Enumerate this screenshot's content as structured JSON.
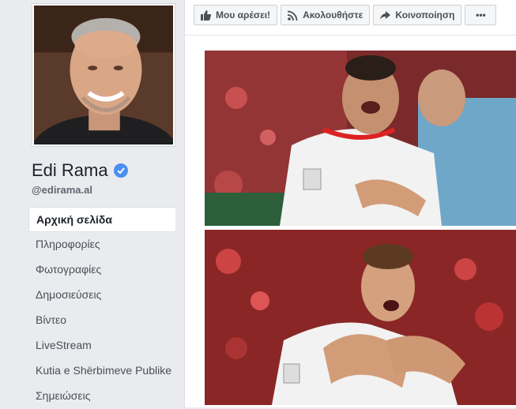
{
  "page": {
    "name": "Edi Rama",
    "handle": "@edirama.al"
  },
  "nav": {
    "items": [
      {
        "label": "Αρχική σελίδα",
        "active": true
      },
      {
        "label": "Πληροφορίες",
        "active": false
      },
      {
        "label": "Φωτογραφίες",
        "active": false
      },
      {
        "label": "Δημοσιεύσεις",
        "active": false
      },
      {
        "label": "Βίντεο",
        "active": false
      },
      {
        "label": "LiveStream",
        "active": false
      },
      {
        "label": "Kutia e Shërbimeve Publike",
        "active": false
      },
      {
        "label": "Σημειώσεις",
        "active": false
      }
    ]
  },
  "actions": {
    "like_label": "Μου αρέσει!",
    "follow_label": "Ακολουθήστε",
    "share_label": "Κοινοποίηση",
    "more_label": "•••"
  },
  "colors": {
    "background": "#e9ebee",
    "verified": "#4a8ef0",
    "text_primary": "#1d2129",
    "text_secondary": "#606770"
  },
  "icons": [
    "thumbs-up-icon",
    "rss-icon",
    "share-arrow-icon",
    "verified-badge-icon"
  ]
}
